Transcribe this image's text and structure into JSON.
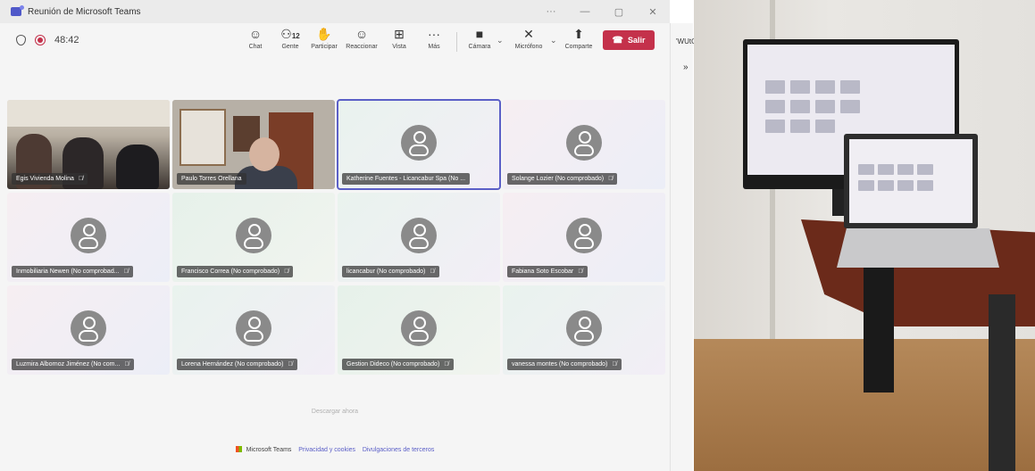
{
  "window": {
    "title": "Reunión de Microsoft Teams",
    "controls": [
      "···",
      "—",
      "▢",
      "✕"
    ]
  },
  "meeting": {
    "timer": "48:42"
  },
  "toolbar": {
    "items": [
      {
        "label": "Chat",
        "icon": "chat-icon",
        "glyph": "☺"
      },
      {
        "label": "Gente",
        "icon": "people-icon",
        "glyph": "⚇",
        "badge": "12"
      },
      {
        "label": "Participar",
        "icon": "raise-hand-icon",
        "glyph": "✋"
      },
      {
        "label": "Reaccionar",
        "icon": "emoji-icon",
        "glyph": "☺"
      },
      {
        "label": "Vista",
        "icon": "grid-view-icon",
        "glyph": "⊞"
      },
      {
        "label": "Más",
        "icon": "more-icon",
        "glyph": "···"
      },
      {
        "label": "Cámara",
        "icon": "camera-icon",
        "glyph": "■"
      },
      {
        "label": "Micrófono",
        "icon": "mic-off-icon",
        "glyph": "✕"
      },
      {
        "label": "Comparte",
        "icon": "share-icon",
        "glyph": "⬆"
      }
    ],
    "caret": "⌄",
    "leave_label": "Salir"
  },
  "participants": [
    {
      "name": "Egis Vivienda Molina",
      "muted": true,
      "video": true
    },
    {
      "name": "Paulo Torres Orellana",
      "muted": false,
      "video": true
    },
    {
      "name": "Katherine Fuentes - Licancabur Spa (No ...",
      "muted": false,
      "active": true
    },
    {
      "name": "Solange Lozier (No comprobado)",
      "muted": true
    },
    {
      "name": "Inmobiliaria Newen (No comprobad...",
      "muted": true
    },
    {
      "name": "Francisco Correa (No comprobado)",
      "muted": true
    },
    {
      "name": "licancabur (No comprobado)",
      "muted": true
    },
    {
      "name": "Fabiana Soto Escobar",
      "muted": true
    },
    {
      "name": "Luzmira Albornoz Jiménez (No com...",
      "muted": true
    },
    {
      "name": "Lorena Hernández (No comprobado)",
      "muted": true
    },
    {
      "name": "Gestion Dideco (No comprobado)",
      "muted": true
    },
    {
      "name": "vanessa montes (No comprobado)",
      "muted": true
    }
  ],
  "download_text": "Descargar ahora",
  "footer": {
    "brand": "Microsoft Teams",
    "privacy": "Privacidad y cookies",
    "third_party": "Divulgaciones de terceros"
  },
  "side": {
    "url_fragment": "'WUtO.",
    "chevron": "»"
  },
  "colors": {
    "accent": "#5b5fc7",
    "leave": "#c4314b"
  }
}
